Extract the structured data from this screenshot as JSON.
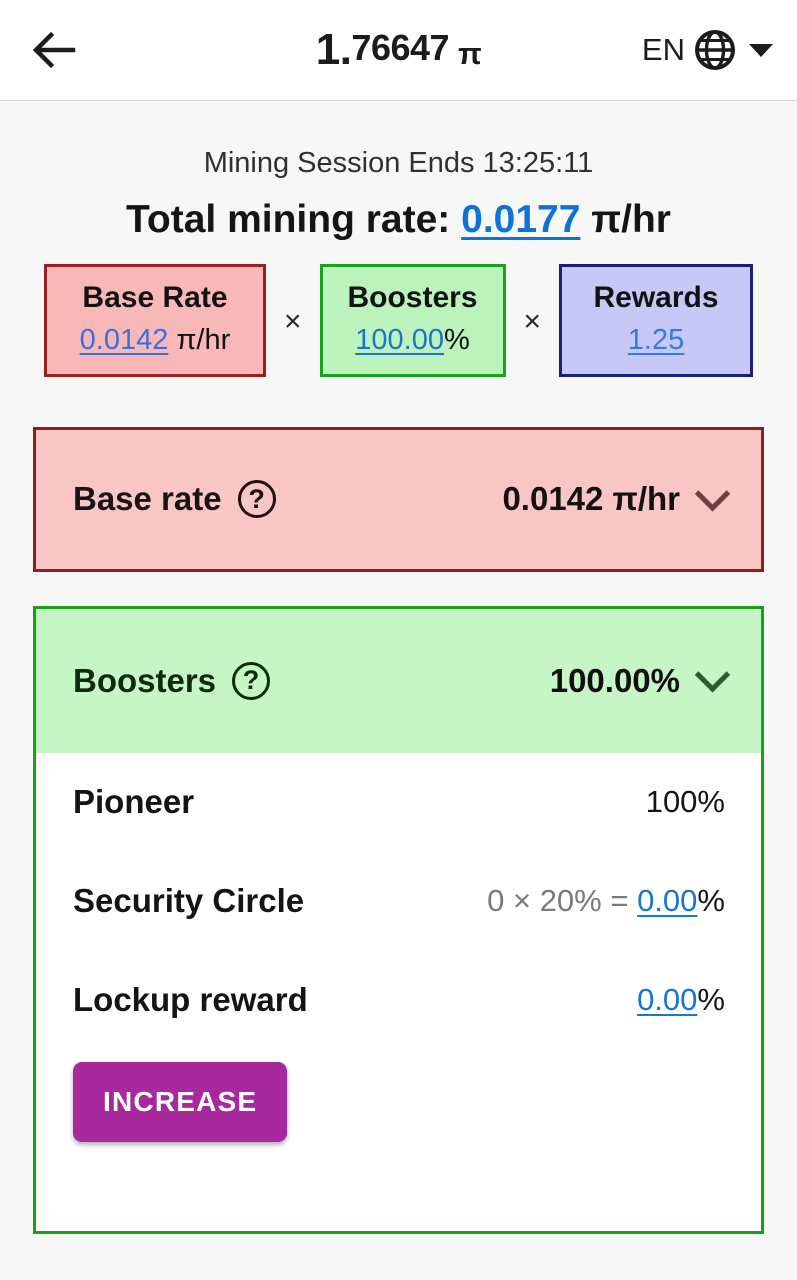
{
  "appbar": {
    "back_icon": "arrow-left-icon",
    "balance_integer": "1.",
    "balance_fraction": "76647",
    "balance_symbol": "π",
    "language_code": "EN",
    "globe_icon": "globe-icon",
    "dropdown_icon": "caret-down-icon"
  },
  "summary": {
    "session_text": "Mining Session Ends 13:25:11",
    "total_label": "Total mining rate:",
    "total_value": "0.0177",
    "total_unit": "π/hr"
  },
  "formula": {
    "operator": "×",
    "boxes": [
      {
        "title": "Base Rate",
        "value": "0.0142",
        "unit": " π/hr"
      },
      {
        "title": "Boosters",
        "value": "100.00",
        "unit": "%"
      },
      {
        "title": "Rewards",
        "value": "1.25",
        "unit": ""
      }
    ]
  },
  "base_rate_section": {
    "label": "Base rate",
    "help_icon": "question-circle-icon",
    "value": "0.0142 π/hr",
    "chevron_icon": "chevron-down-icon"
  },
  "boosters_section": {
    "label": "Boosters",
    "help_icon": "question-circle-icon",
    "value": "100.00%",
    "chevron_icon": "chevron-down-icon",
    "rows": [
      {
        "label": "Pioneer",
        "prefix": "",
        "link": "",
        "suffix": "100%"
      },
      {
        "label": "Security Circle",
        "prefix": "0 × 20% = ",
        "link": "0.00",
        "suffix": "%"
      },
      {
        "label": "Lockup reward",
        "prefix": "",
        "link": "0.00",
        "suffix": "%"
      }
    ],
    "increase_button": "INCREASE"
  },
  "colors": {
    "link_blue": "#0f72d6",
    "base_fill": "#f9c5c5",
    "base_border": "#8f1f1f",
    "boost_fill": "#c6f5c6",
    "boost_border": "#17a217",
    "rewards_fill": "#c8c8f8",
    "rewards_border": "#1d1d7a",
    "increase_button": "#a8289e",
    "page_bg": "#f7f7f7"
  }
}
